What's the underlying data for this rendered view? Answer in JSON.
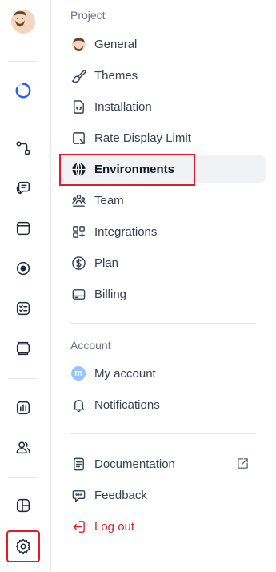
{
  "sections": {
    "project": "Project",
    "account": "Account"
  },
  "project_items": [
    {
      "label": "General",
      "icon": "user-avatar-icon"
    },
    {
      "label": "Themes",
      "icon": "brush-icon"
    },
    {
      "label": "Installation",
      "icon": "code-file-icon"
    },
    {
      "label": "Rate Display Limit",
      "icon": "rate-limit-icon"
    },
    {
      "label": "Environments",
      "icon": "globe-icon",
      "active": true
    },
    {
      "label": "Team",
      "icon": "team-icon"
    },
    {
      "label": "Integrations",
      "icon": "integrations-icon"
    },
    {
      "label": "Plan",
      "icon": "dollar-icon"
    },
    {
      "label": "Billing",
      "icon": "credit-card-icon"
    }
  ],
  "account_items": [
    {
      "label": "My account",
      "avatar_letter": "m"
    },
    {
      "label": "Notifications",
      "icon": "bell-icon"
    }
  ],
  "bottom_items": [
    {
      "label": "Documentation",
      "icon": "document-icon"
    },
    {
      "label": "Feedback",
      "icon": "feedback-icon"
    },
    {
      "label": "Log out",
      "icon": "logout-icon"
    }
  ],
  "colors": {
    "highlight": "#e11d2b",
    "logout": "#dc2626",
    "active_bg": "#f1f2f4",
    "progress_ring": "#2563eb"
  }
}
